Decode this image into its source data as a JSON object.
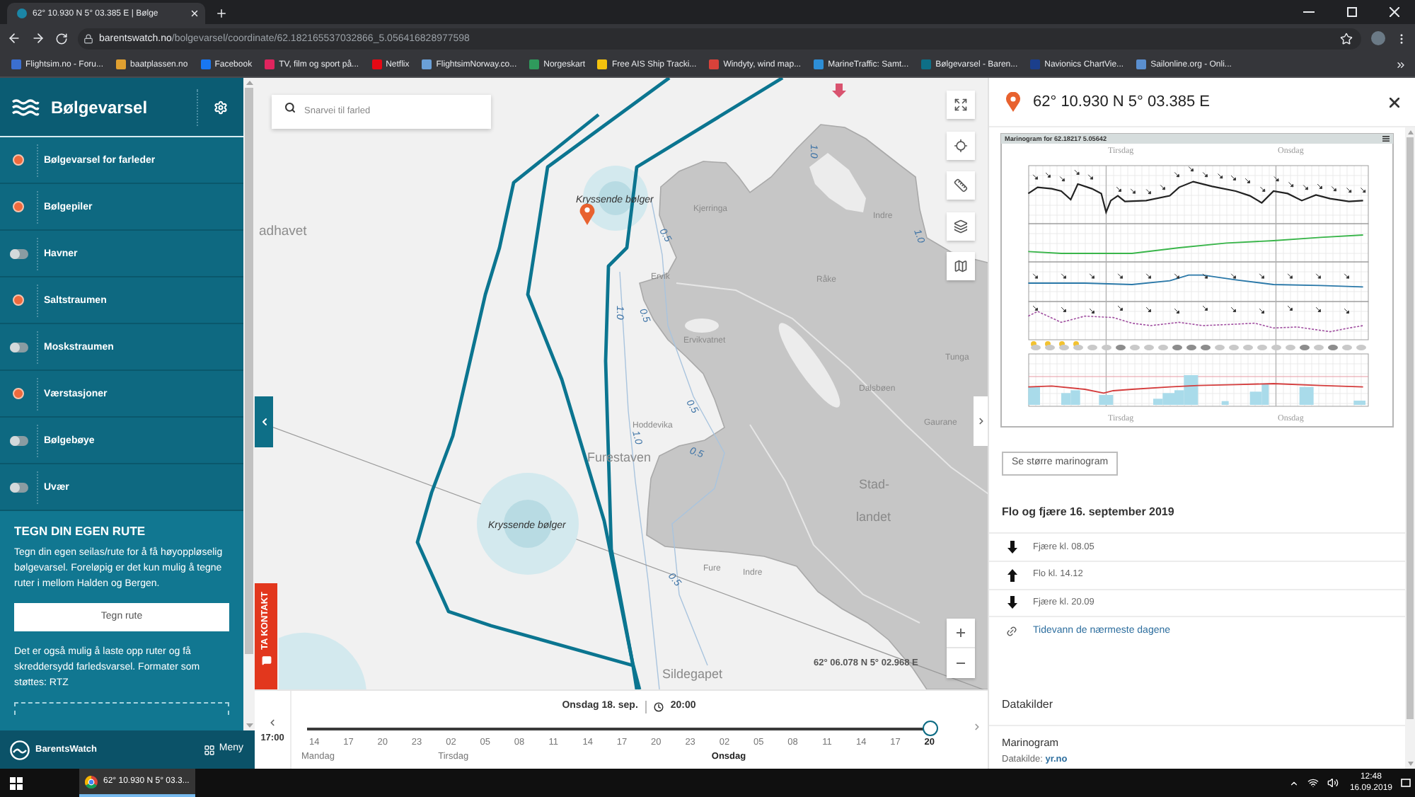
{
  "browser": {
    "tab_title": "62° 10.930 N 5° 03.385 E | Bølge",
    "url": {
      "host": "barentswatch.no",
      "path": "/bolgevarsel/coordinate/62.182165537032866_5.056416828977598"
    },
    "bookmarks": [
      "Flightsim.no - Foru...",
      "baatplassen.no",
      "Facebook",
      "TV, film og sport på...",
      "Netflix",
      "FlightsimNorway.co...",
      "Norgeskart",
      "Free AIS Ship Tracki...",
      "Windyty, wind map...",
      "MarineTraffic: Samt...",
      "Bølgevarsel - Baren...",
      "Navionics ChartVie...",
      "Sailonline.org - Onli..."
    ]
  },
  "sidebar": {
    "title": "Bølgevarsel",
    "layers": [
      {
        "label": "Bølgevarsel for farleder",
        "on": true
      },
      {
        "label": "Bølgepiler",
        "on": true
      },
      {
        "label": "Havner",
        "on": false
      },
      {
        "label": "Saltstraumen",
        "on": true
      },
      {
        "label": "Moskstraumen",
        "on": false
      },
      {
        "label": "Værstasjoner",
        "on": true
      },
      {
        "label": "Bølgebøye",
        "on": false
      },
      {
        "label": "Uvær",
        "on": false
      }
    ],
    "route": {
      "title": "TEGN DIN EGEN RUTE",
      "text": "Tegn din egen seilas/rute for å få høyoppløselig bølgevarsel. Foreløpig er det kun mulig å tegne ruter i mellom Halden og Bergen.",
      "button": "Tegn rute",
      "upload_text": "Det er også mulig å laste opp ruter og få skreddersydd farledsvarsel. Formater som støttes: RTZ"
    },
    "footer": {
      "brand": "BarentsWatch",
      "menu": "Meny"
    }
  },
  "map": {
    "search": {
      "placeholder": "Snarvei til farled"
    },
    "labels": [
      {
        "text": "adhavet",
        "kind": "sea"
      },
      {
        "text": "Kryssende bølger",
        "kind": "warning"
      },
      {
        "text": "Kjerringa",
        "kind": "place"
      },
      {
        "text": "Ervik",
        "kind": "place"
      },
      {
        "text": "Ervikvatnet",
        "kind": "place"
      },
      {
        "text": "Hoddevika",
        "kind": "place"
      },
      {
        "text": "Furestaven",
        "kind": "area"
      },
      {
        "text": "Kryssende bølger",
        "kind": "warning"
      },
      {
        "text": "Stad-",
        "kind": "area"
      },
      {
        "text": "landet",
        "kind": "area"
      },
      {
        "text": "Fure",
        "kind": "place"
      },
      {
        "text": "Indre",
        "kind": "place"
      },
      {
        "text": "Sildegapet",
        "kind": "area"
      },
      {
        "text": "Indre",
        "kind": "place"
      },
      {
        "text": "Råke",
        "kind": "place"
      },
      {
        "text": "Dalsbøen",
        "kind": "place"
      },
      {
        "text": "Gaurane",
        "kind": "place"
      },
      {
        "text": "Tunga",
        "kind": "place"
      },
      {
        "text": "1.0",
        "kind": "depth"
      },
      {
        "text": "0.5",
        "kind": "depth"
      },
      {
        "text": "1.0",
        "kind": "depth"
      },
      {
        "text": "0.5",
        "kind": "depth"
      },
      {
        "text": "0.5",
        "kind": "depth"
      },
      {
        "text": "1.0",
        "kind": "depth"
      },
      {
        "text": "0.5",
        "kind": "depth"
      },
      {
        "text": "0.5",
        "kind": "depth"
      },
      {
        "text": "1.0",
        "kind": "depth"
      }
    ],
    "coordinates": "62° 06.078 N 5° 02.968 E",
    "contact_tab": "TA KONTAKT"
  },
  "timeline": {
    "start_time": "17:00",
    "date": "Onsdag 18. sep.",
    "time": "20:00",
    "level": 1,
    "days": [
      {
        "label": "Mandag",
        "selected": false,
        "ticks": [
          {
            "label": "14",
            "selected": false
          },
          {
            "label": "17",
            "selected": false
          },
          {
            "label": "20",
            "selected": false
          },
          {
            "label": "23",
            "selected": false
          }
        ]
      },
      {
        "label": "Tirsdag",
        "selected": false,
        "ticks": [
          {
            "label": "02",
            "selected": false
          },
          {
            "label": "05",
            "selected": false
          },
          {
            "label": "08",
            "selected": false
          },
          {
            "label": "11",
            "selected": false
          },
          {
            "label": "14",
            "selected": false
          },
          {
            "label": "17",
            "selected": false
          },
          {
            "label": "20",
            "selected": false
          },
          {
            "label": "23",
            "selected": false
          }
        ]
      },
      {
        "label": "Onsdag",
        "selected": true,
        "ticks": [
          {
            "label": "02",
            "selected": false
          },
          {
            "label": "05",
            "selected": false
          },
          {
            "label": "08",
            "selected": false
          },
          {
            "label": "11",
            "selected": false
          },
          {
            "label": "14",
            "selected": false
          },
          {
            "label": "17",
            "selected": false
          },
          {
            "label": "20",
            "selected": true
          }
        ]
      }
    ]
  },
  "panel": {
    "title": "62° 10.930 N 5° 03.385 E",
    "marinogram": {
      "title": "Marinogram for 62.18217 5.05642",
      "days_top": [
        "Tirsdag",
        "Onsdag"
      ],
      "days_bottom": [
        "Tirsdag",
        "Onsdag"
      ]
    },
    "more_button": "Se større marinogram",
    "tide": {
      "heading": "Flo og fjære 16. september 2019",
      "rows": [
        {
          "kind": "low",
          "text": "Fjære kl. 08.05"
        },
        {
          "kind": "high",
          "text": "Flo kl. 14.12"
        },
        {
          "kind": "low",
          "text": "Fjære kl. 20.09"
        }
      ],
      "link": "Tidevann de nærmeste dagene"
    },
    "sources": {
      "heading": "Datakilder",
      "items": [
        {
          "name": "Marinogram",
          "label": "Datakilde:",
          "link": "yr.no"
        }
      ]
    }
  },
  "taskbar": {
    "window": "62° 10.930 N 5° 03.3...",
    "time": "12:48",
    "date": "16.09.2019"
  }
}
